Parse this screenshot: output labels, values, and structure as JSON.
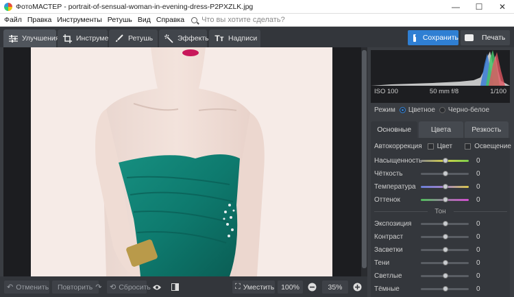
{
  "window": {
    "title": "ФотоМАСТЕР - portrait-of-sensual-woman-in-evening-dress-P2PXZLK.jpg",
    "controls": {
      "minimize": "—",
      "maximize": "☐",
      "close": "✕"
    }
  },
  "menu": {
    "items": [
      "Файл",
      "Правка",
      "Инструменты",
      "Ретушь",
      "Вид",
      "Справка"
    ],
    "search_placeholder": "Что вы хотите сделать?"
  },
  "toolbar": {
    "tabs": [
      {
        "label": "Улучшения",
        "icon": "sliders-icon"
      },
      {
        "label": "Инструменты",
        "icon": "crop-icon"
      },
      {
        "label": "Ретушь",
        "icon": "brush-icon"
      },
      {
        "label": "Эффекты",
        "icon": "magic-wand-icon"
      },
      {
        "label": "Надписи",
        "icon": "text-icon"
      }
    ],
    "save_label": "Сохранить",
    "print_label": "Печать"
  },
  "bottom": {
    "undo_label": "Отменить",
    "redo_label": "Повторить",
    "reset_label": "Сбросить",
    "fit_label": "Уместить",
    "zoom_100": "100%",
    "zoom_level": "35%"
  },
  "histogram": {
    "iso": "ISO 100",
    "lens": "50 mm f/8",
    "shutter": "1/100"
  },
  "mode": {
    "label": "Режим",
    "color": "Цветное",
    "bw": "Черно-белое",
    "selected": "Цветное"
  },
  "subtabs": [
    "Основные",
    "Цвета",
    "Резкость"
  ],
  "auto": {
    "label": "Автокоррекция",
    "color": "Цвет",
    "light": "Освещение"
  },
  "sliders_main": [
    {
      "label": "Насыщенность",
      "value": "0",
      "gradient": [
        "#8a8a8a",
        "#d4d24a",
        "#7dd04a"
      ]
    },
    {
      "label": "Чёткость",
      "value": "0",
      "gradient": [
        "#5a5e64",
        "#5a5e64"
      ]
    },
    {
      "label": "Температура",
      "value": "0",
      "gradient": [
        "#6a7fd8",
        "#a583c9",
        "#d9c84a"
      ]
    },
    {
      "label": "Оттенок",
      "value": "0",
      "gradient": [
        "#4fbf5a",
        "#9a7fa0",
        "#d24fd0"
      ]
    }
  ],
  "tone": {
    "heading": "Тон",
    "sliders": [
      {
        "label": "Экспозиция",
        "value": "0"
      },
      {
        "label": "Контраст",
        "value": "0"
      },
      {
        "label": "Засветки",
        "value": "0"
      },
      {
        "label": "Тени",
        "value": "0"
      },
      {
        "label": "Светлые",
        "value": "0"
      },
      {
        "label": "Тёмные",
        "value": "0"
      }
    ]
  },
  "colors": {
    "accent": "#2f7fd3",
    "dress": "#0e7a6e",
    "background_photo": "#f6ebe7"
  }
}
